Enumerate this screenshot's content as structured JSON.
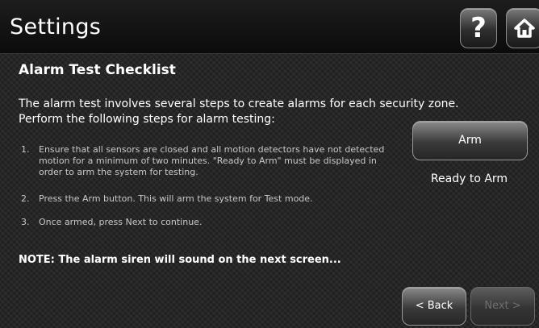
{
  "header": {
    "title": "Settings",
    "help_icon": "question-mark-icon",
    "help_glyph": "?",
    "home_icon": "home-icon"
  },
  "main": {
    "section_title": "Alarm Test Checklist",
    "intro": "The alarm test involves several steps to create alarms for each security zone. Perform the following steps for alarm testing:",
    "steps": [
      {
        "number": "1.",
        "text": "Ensure that all sensors are closed and all motion detectors have not detected motion for a minimum of two minutes. \"Ready to Arm\" must be displayed in order to arm the system for testing."
      },
      {
        "number": "2.",
        "text": "Press the Arm button. This will arm the system for Test mode."
      },
      {
        "number": "3.",
        "text": "Once armed, press Next to continue."
      }
    ],
    "note": "NOTE: The alarm siren will sound on the next screen...",
    "arm_label": "Arm",
    "status": "Ready to Arm"
  },
  "footer": {
    "back_label": "< Back",
    "next_label": "Next >",
    "next_enabled": false
  },
  "colors": {
    "header_bg": "#101010",
    "content_bg": "#262626",
    "text": "#ffffff",
    "step_text": "#c8c8c8",
    "disabled_text": "#6e6e6e"
  }
}
